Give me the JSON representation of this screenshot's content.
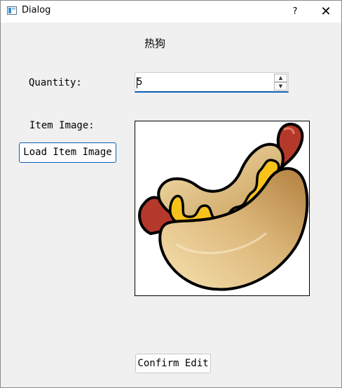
{
  "window": {
    "title": "Dialog",
    "help_symbol": "?",
    "close_symbol": "✕"
  },
  "form": {
    "header": "热狗",
    "quantity_label": "Quantity:",
    "quantity_value": "5",
    "item_image_label": "Item Image:",
    "load_button": "Load Item Image",
    "confirm_button": "Confirm Edit"
  },
  "image": {
    "icon": "hotdog-image",
    "colors": {
      "sausage": "#b5392a",
      "bun_light": "#f2d89e",
      "bun_dark": "#b78645",
      "mustard": "#f7c21a"
    }
  },
  "theme": {
    "focus_accent": "#0a5fb4"
  }
}
